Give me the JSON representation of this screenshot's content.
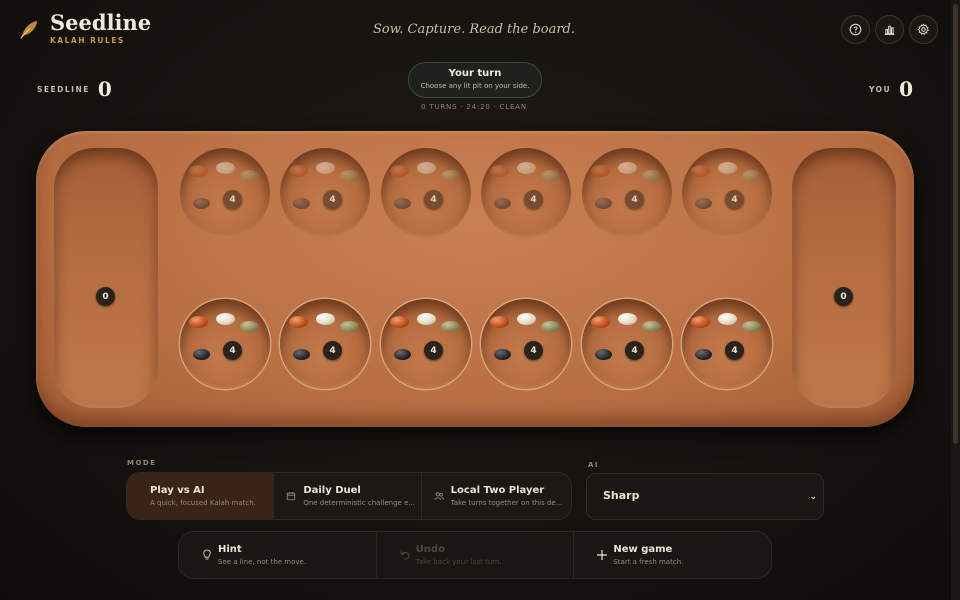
{
  "brand": {
    "title": "Seedline",
    "subtitle": "KALAH RULES"
  },
  "tagline": "Sow. Capture. Read the board.",
  "header_buttons": [
    {
      "name": "help-button",
      "icon": "question-circle-icon"
    },
    {
      "name": "stats-button",
      "icon": "bar-chart-icon"
    },
    {
      "name": "settings-button",
      "icon": "gear-icon"
    }
  ],
  "scores": {
    "opponent": {
      "label": "SEEDLINE",
      "value": "0"
    },
    "player": {
      "label": "YOU",
      "value": "0"
    }
  },
  "turn": {
    "title": "Your turn",
    "subtitle": "Choose any lit pit on your side.",
    "meta": "0 TURNS · 24:20 · CLEAN"
  },
  "board": {
    "stores": {
      "left": "0",
      "right": "0"
    },
    "top_pits": [
      "4",
      "4",
      "4",
      "4",
      "4",
      "4"
    ],
    "bottom_pits": [
      "4",
      "4",
      "4",
      "4",
      "4",
      "4"
    ],
    "seed_colors": [
      "red",
      "white",
      "olive",
      "black"
    ]
  },
  "mode": {
    "label": "MODE",
    "options": [
      {
        "title": "Play vs AI",
        "desc": "A quick, focused Kalah match.",
        "icon": "",
        "active": true
      },
      {
        "title": "Daily Duel",
        "desc": "One deterministic challenge e...",
        "icon": "calendar-icon",
        "active": false
      },
      {
        "title": "Local Two Player",
        "desc": "Take turns together on this de...",
        "icon": "users-icon",
        "active": false
      }
    ]
  },
  "ai": {
    "label": "AI",
    "selected": "Sharp"
  },
  "actions": [
    {
      "title": "Hint",
      "desc": "See a line, not the move.",
      "icon": "lightbulb-icon",
      "enabled": true
    },
    {
      "title": "Undo",
      "desc": "Take back your last turn.",
      "icon": "undo-icon",
      "enabled": false
    },
    {
      "title": "New game",
      "desc": "Start a fresh match.",
      "icon": "plus-icon",
      "enabled": true
    }
  ],
  "colors": {
    "accent": "#c79a3a",
    "board": "#b86f43",
    "background": "#14110e"
  }
}
